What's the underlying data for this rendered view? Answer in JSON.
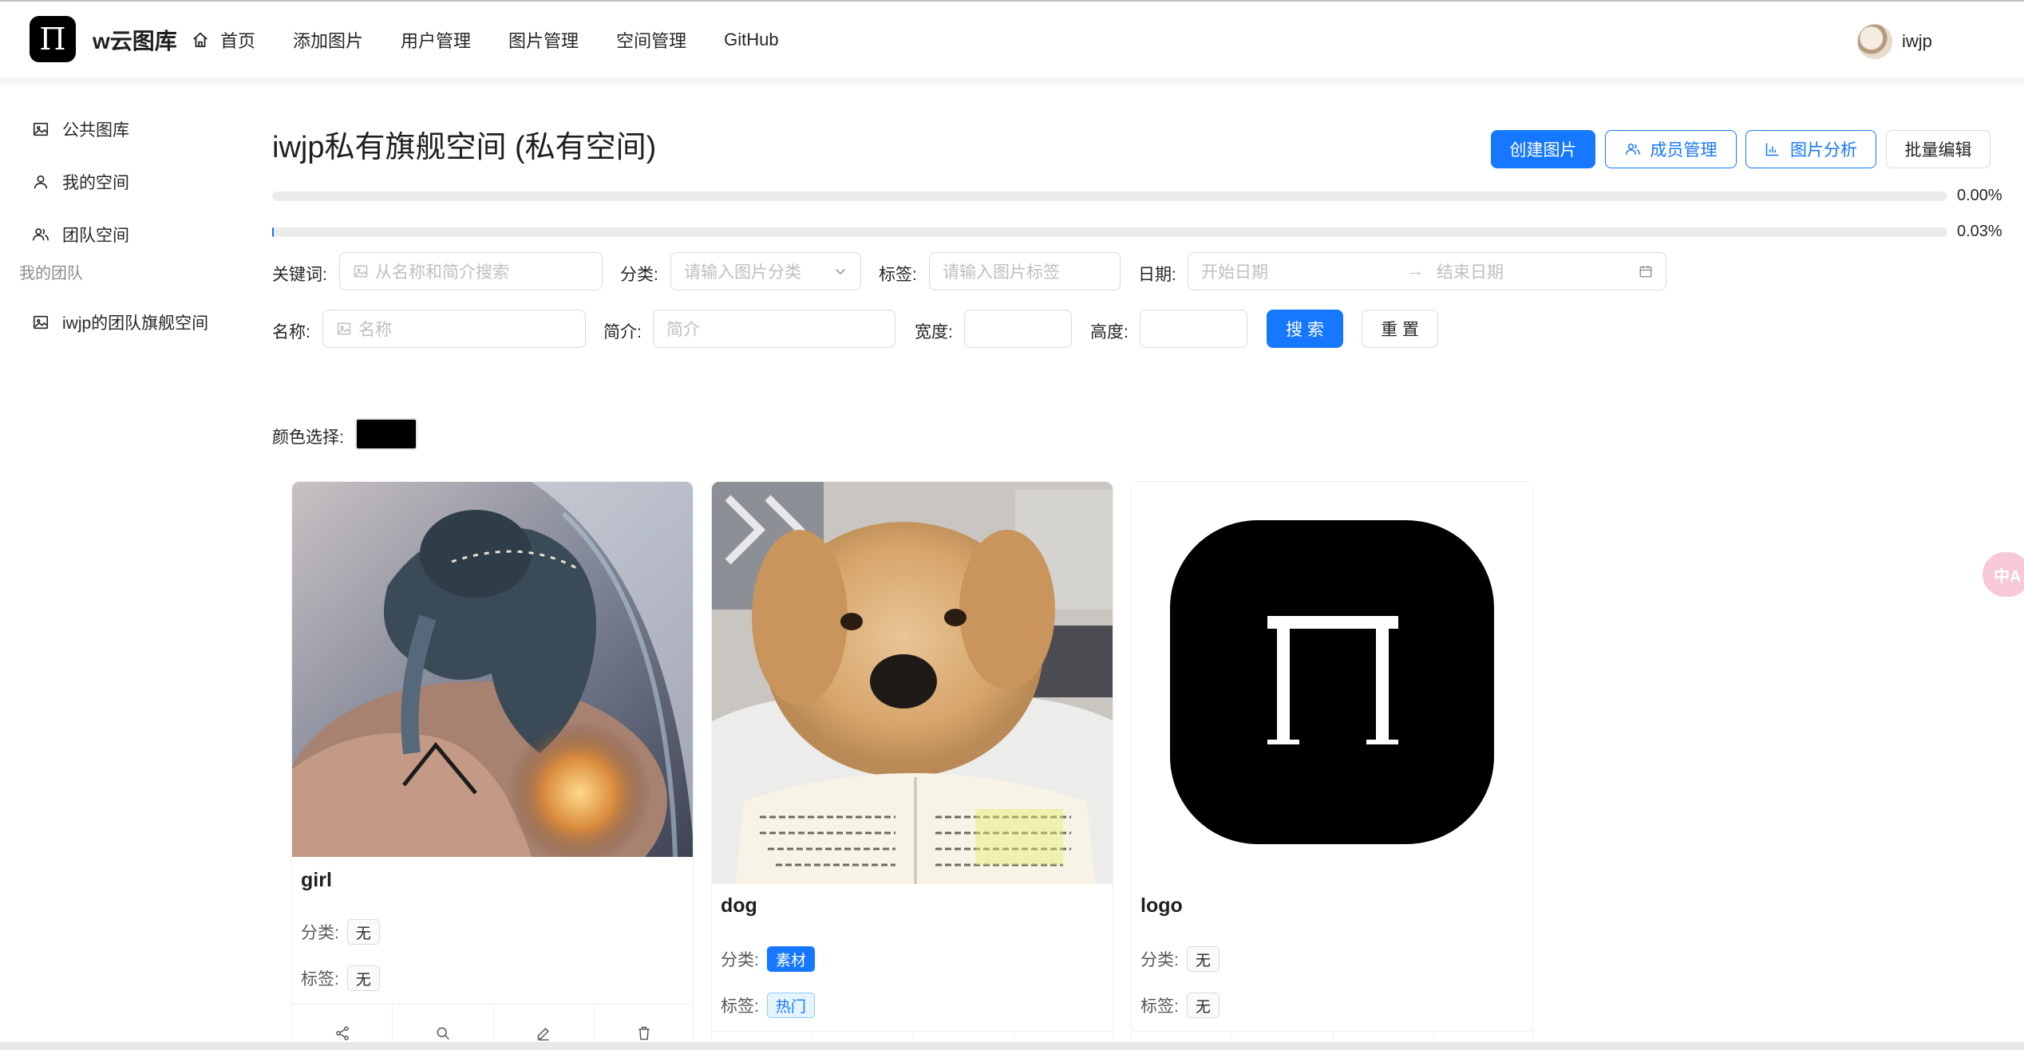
{
  "app": {
    "logo_glyph": "Π",
    "brand": "w云图库"
  },
  "nav": {
    "items": [
      "首页",
      "添加图片",
      "用户管理",
      "图片管理",
      "空间管理",
      "GitHub"
    ]
  },
  "user": {
    "name": "iwjp"
  },
  "sidebar": {
    "items": [
      "公共图库",
      "我的空间",
      "团队空间"
    ],
    "group_label": "我的团队",
    "team_items": [
      "iwjp的团队旗舰空间"
    ]
  },
  "page": {
    "title": "iwjp私有旗舰空间 (私有空间)",
    "buttons": {
      "create": "创建图片",
      "members": "成员管理",
      "analysis": "图片分析",
      "batch_edit": "批量编辑"
    },
    "progress": [
      {
        "text": "0.00%",
        "value": 0.0
      },
      {
        "text": "0.03%",
        "value": 0.03
      }
    ]
  },
  "filters": {
    "keyword_label": "关键词:",
    "keyword_placeholder": "从名称和简介搜索",
    "category_label": "分类:",
    "category_placeholder": "请输入图片分类",
    "tags_label": "标签:",
    "tags_placeholder": "请输入图片标签",
    "date_label": "日期:",
    "date_start_placeholder": "开始日期",
    "date_end_placeholder": "结束日期",
    "name_label": "名称:",
    "name_placeholder": "名称",
    "intro_label": "简介:",
    "intro_placeholder": "简介",
    "width_label": "宽度:",
    "height_label": "高度:",
    "search_button": "搜 索",
    "reset_button": "重 置",
    "color_label": "颜色选择:",
    "color_value": "#000000"
  },
  "cards": [
    {
      "name": "girl",
      "category_label": "分类:",
      "category": "无",
      "tags_label": "标签:",
      "tag": "无"
    },
    {
      "name": "dog",
      "category_label": "分类:",
      "category": "素材",
      "tags_label": "标签:",
      "tag": "热门"
    },
    {
      "name": "logo",
      "category_label": "分类:",
      "category": "无",
      "tags_label": "标签:",
      "tag": "无"
    }
  ],
  "card_action_icons": [
    "share-icon",
    "search-icon",
    "edit-icon",
    "delete-icon"
  ],
  "translate_fab": {
    "glyph": "中A"
  },
  "colors": {
    "primary": "#1677ff",
    "border": "#d9d9d9"
  }
}
